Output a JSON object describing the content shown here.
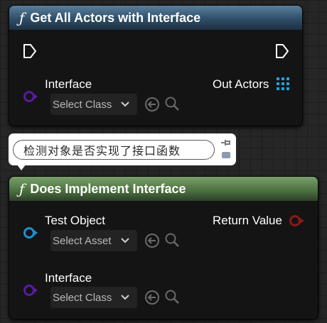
{
  "node1": {
    "title": "Get All Actors with Interface",
    "interface_label": "Interface",
    "interface_select": "Select Class",
    "out_label": "Out Actors"
  },
  "comment": {
    "text": "检测对象是否实现了接口函数"
  },
  "node2": {
    "title": "Does Implement Interface",
    "test_object_label": "Test Object",
    "test_object_select": "Select Asset",
    "return_label": "Return Value",
    "interface_label": "Interface",
    "interface_select": "Select Class"
  },
  "icons": {
    "function": "function-icon",
    "exec": "exec-pin-icon",
    "browse": "browse-arrow-icon",
    "search": "search-icon",
    "chevron": "chevron-down-icon",
    "array": "array-grid-icon",
    "pushpin": "pushpin-icon"
  },
  "colors": {
    "node1_header": "#2e4e68",
    "node2_header": "#4d7440",
    "interface_pin": "#5a1aa0",
    "object_pin": "#1f8fd0",
    "bool_pin": "#8b1a1a",
    "array_pin": "#1fa0e0"
  }
}
